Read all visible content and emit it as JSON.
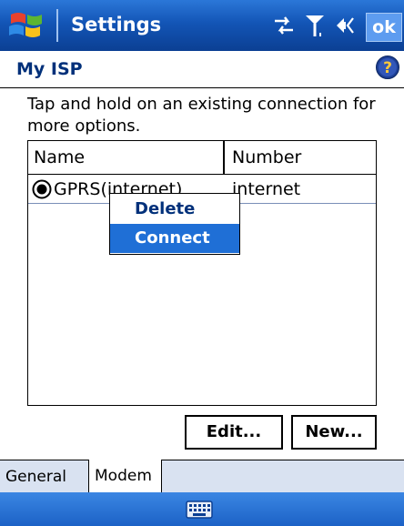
{
  "titlebar": {
    "title": "Settings",
    "ok_label": "ok",
    "icons": [
      "windows-flag-icon",
      "connectivity-icon",
      "signal-icon",
      "volume-icon"
    ]
  },
  "page": {
    "title": "My ISP",
    "help_icon": "help-icon"
  },
  "instruction": "Tap and hold on an existing connection for more options.",
  "listview": {
    "columns": [
      "Name",
      "Number"
    ],
    "rows": [
      {
        "name": "GPRS(internet)",
        "number": "internet",
        "selected": true
      }
    ]
  },
  "context_menu": {
    "items": [
      "Delete",
      "Connect"
    ],
    "highlighted": "Connect"
  },
  "buttons": {
    "edit": "Edit...",
    "new": "New..."
  },
  "tabs": {
    "items": [
      "General",
      "Modem"
    ],
    "active": "Modem"
  },
  "command_bar": {
    "icon": "keyboard-icon"
  },
  "colors": {
    "titlebar": "#1355b6",
    "highlight": "#1f6fd6",
    "heading": "#00307a",
    "tab_strip": "#d9e2f1"
  }
}
